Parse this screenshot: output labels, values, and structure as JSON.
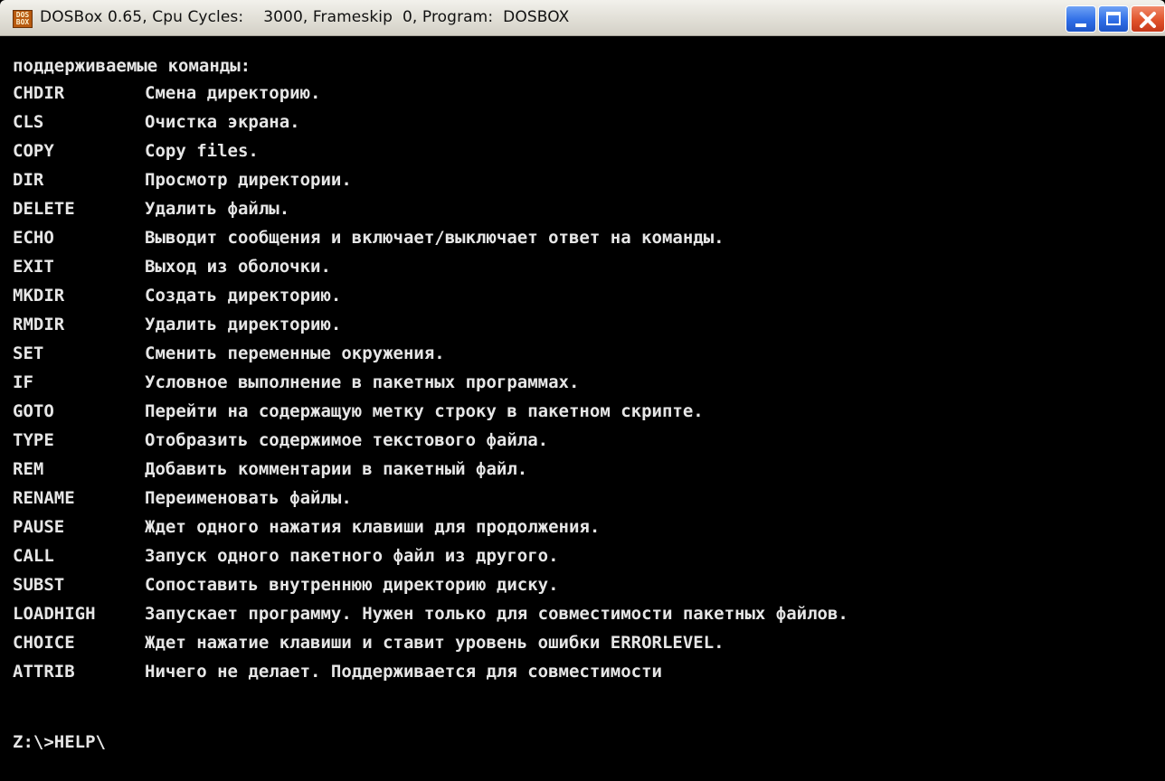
{
  "window": {
    "title": "DOSBox 0.65, Cpu Cycles:    3000, Frameskip  0, Program:  DOSBOX",
    "icon": "dosbox-app-icon",
    "icon_text_top": "DOS",
    "icon_text_bottom": "BOX"
  },
  "terminal": {
    "heading": "поддерживаемые команды:",
    "commands": [
      {
        "name": "CHDIR",
        "description": "Смена директорию."
      },
      {
        "name": "CLS",
        "description": "Очистка экрана."
      },
      {
        "name": "COPY",
        "description": "Copy files."
      },
      {
        "name": "DIR",
        "description": "Просмотр директории."
      },
      {
        "name": "DELETE",
        "description": "Удалить файлы."
      },
      {
        "name": "ECHO",
        "description": "Выводит сообщения и включает/выключает ответ на команды."
      },
      {
        "name": "EXIT",
        "description": "Выход из оболочки."
      },
      {
        "name": "MKDIR",
        "description": "Создать директорию."
      },
      {
        "name": "RMDIR",
        "description": "Удалить директорию."
      },
      {
        "name": "SET",
        "description": "Сменить переменные окружения."
      },
      {
        "name": "IF",
        "description": "Условное выполнение в пакетных программах."
      },
      {
        "name": "GOTO",
        "description": "Перейти на содержащую метку строку в пакетном скрипте."
      },
      {
        "name": "TYPE",
        "description": "Отобразить содержимое текстового файла."
      },
      {
        "name": "REM",
        "description": "Добавить комментарии в пакетный файл."
      },
      {
        "name": "RENAME",
        "description": "Переименовать файлы."
      },
      {
        "name": "PAUSE",
        "description": "Ждет одного нажатия клавиши для продолжения."
      },
      {
        "name": "CALL",
        "description": "Запуск одного пакетного файл из другого."
      },
      {
        "name": "SUBST",
        "description": "Сопоставить внутреннюю директорию диску."
      },
      {
        "name": "LOADHIGH",
        "description": "Запускает программу. Нужен только для совместимости пакетных файлов."
      },
      {
        "name": "CHOICE",
        "description": "Ждет нажатие клавиши и ставит уровень ошибки ERRORLEVEL."
      },
      {
        "name": "ATTRIB",
        "description": "Ничего не делает. Поддерживается для совместимости"
      }
    ],
    "prompt": "Z:\\>HELP\\"
  },
  "colors": {
    "terminal_bg": "#000000",
    "terminal_text": "#e6e6e6",
    "close_button": "#e0532b",
    "window_button": "#2f6ee6"
  }
}
